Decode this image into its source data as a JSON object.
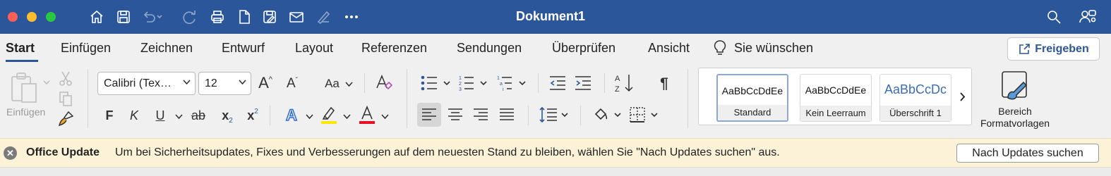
{
  "window": {
    "title": "Dokument1",
    "title_bar_color": "#2b579a"
  },
  "quick_access": {
    "icons": [
      "home-icon",
      "save-icon",
      "undo-icon",
      "redo-icon",
      "print-icon",
      "new-document-icon",
      "save-as-icon",
      "mail-icon",
      "pen-icon",
      "more-icon"
    ]
  },
  "tabs": [
    {
      "label": "Start",
      "active": true
    },
    {
      "label": "Einfügen"
    },
    {
      "label": "Zeichnen"
    },
    {
      "label": "Entwurf"
    },
    {
      "label": "Layout"
    },
    {
      "label": "Referenzen"
    },
    {
      "label": "Sendungen"
    },
    {
      "label": "Überprüfen"
    },
    {
      "label": "Ansicht"
    },
    {
      "label": "Sie wünschen"
    }
  ],
  "share_button": {
    "label": "Freigeben"
  },
  "clipboard": {
    "paste_label": "Einfügen"
  },
  "font": {
    "family": "Calibri (Tex…",
    "size": "12",
    "change_case_label": "Aa",
    "bold": "F",
    "italic": "K",
    "underline": "U",
    "strikethrough": "ab",
    "subscript": "x",
    "superscript": "x",
    "highlight_color": "#ffe600",
    "font_color": "#e81123"
  },
  "styles": [
    {
      "sample": "AaBbCcDdEe",
      "name": "Standard",
      "selected": true
    },
    {
      "sample": "AaBbCcDdEe",
      "name": "Kein Leerraum"
    },
    {
      "sample": "AaBbCcDc",
      "name": "Überschrift 1"
    }
  ],
  "styles_pane": {
    "line1": "Bereich",
    "line2": "Formatvorlagen"
  },
  "notification": {
    "title": "Office Update",
    "message": "Um bei Sicherheitsupdates, Fixes und Verbesserungen auf dem neuesten Stand zu bleiben, wählen Sie \"Nach Updates suchen\" aus.",
    "button": "Nach Updates suchen"
  }
}
